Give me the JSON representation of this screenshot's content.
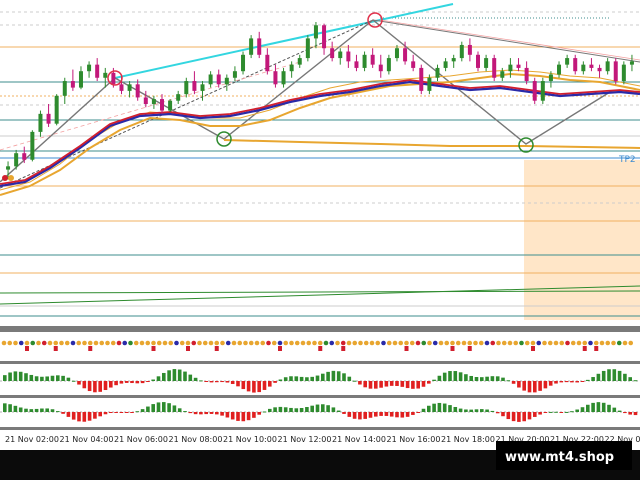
{
  "watermark": "www.mt4.shop",
  "chart_data": {
    "type": "candlestick",
    "symbol": "",
    "x_ticks": [
      "21 Nov 02:00",
      "21 Nov 04:00",
      "21 Nov 06:00",
      "21 Nov 08:00",
      "21 Nov 10:00",
      "21 Nov 12:00",
      "21 Nov 14:00",
      "21 Nov 16:00",
      "21 Nov 18:00",
      "21 Nov 20:00",
      "21 Nov 22:00",
      "22 Nov 0"
    ],
    "price_lines": [
      {
        "label": "",
        "color": "#3e8e8e",
        "style": "dotted"
      },
      {
        "label": "TP2",
        "color": "#3d8bd0",
        "style": "solid"
      }
    ],
    "candles": [
      [
        0.1,
        0.15,
        0.04,
        0.12
      ],
      [
        0.12,
        0.22,
        0.1,
        0.2
      ],
      [
        0.2,
        0.24,
        0.14,
        0.16
      ],
      [
        0.16,
        0.34,
        0.15,
        0.33
      ],
      [
        0.33,
        0.46,
        0.3,
        0.44
      ],
      [
        0.44,
        0.5,
        0.36,
        0.38
      ],
      [
        0.38,
        0.56,
        0.37,
        0.55
      ],
      [
        0.55,
        0.66,
        0.5,
        0.64
      ],
      [
        0.64,
        0.71,
        0.58,
        0.6
      ],
      [
        0.6,
        0.73,
        0.59,
        0.7
      ],
      [
        0.7,
        0.76,
        0.66,
        0.74
      ],
      [
        0.74,
        0.78,
        0.64,
        0.66
      ],
      [
        0.66,
        0.72,
        0.6,
        0.69
      ],
      [
        0.69,
        0.72,
        0.6,
        0.62
      ],
      [
        0.62,
        0.67,
        0.56,
        0.58
      ],
      [
        0.58,
        0.64,
        0.54,
        0.62
      ],
      [
        0.62,
        0.65,
        0.52,
        0.54
      ],
      [
        0.54,
        0.58,
        0.48,
        0.5
      ],
      [
        0.5,
        0.55,
        0.47,
        0.53
      ],
      [
        0.53,
        0.56,
        0.44,
        0.46
      ],
      [
        0.46,
        0.53,
        0.45,
        0.52
      ],
      [
        0.52,
        0.58,
        0.5,
        0.56
      ],
      [
        0.56,
        0.66,
        0.54,
        0.64
      ],
      [
        0.64,
        0.7,
        0.56,
        0.58
      ],
      [
        0.58,
        0.64,
        0.52,
        0.62
      ],
      [
        0.62,
        0.7,
        0.6,
        0.68
      ],
      [
        0.68,
        0.71,
        0.6,
        0.62
      ],
      [
        0.62,
        0.68,
        0.58,
        0.66
      ],
      [
        0.66,
        0.73,
        0.64,
        0.7
      ],
      [
        0.7,
        0.82,
        0.68,
        0.8
      ],
      [
        0.8,
        0.92,
        0.78,
        0.9
      ],
      [
        0.9,
        0.94,
        0.78,
        0.8
      ],
      [
        0.8,
        0.84,
        0.68,
        0.7
      ],
      [
        0.7,
        0.74,
        0.6,
        0.62
      ],
      [
        0.62,
        0.72,
        0.6,
        0.7
      ],
      [
        0.7,
        0.76,
        0.66,
        0.74
      ],
      [
        0.74,
        0.8,
        0.72,
        0.78
      ],
      [
        0.78,
        0.92,
        0.76,
        0.9
      ],
      [
        0.9,
        1.0,
        0.84,
        0.98
      ],
      [
        0.98,
        0.99,
        0.8,
        0.84
      ],
      [
        0.84,
        0.88,
        0.76,
        0.78
      ],
      [
        0.78,
        0.84,
        0.74,
        0.82
      ],
      [
        0.82,
        0.86,
        0.72,
        0.76
      ],
      [
        0.76,
        0.8,
        0.7,
        0.72
      ],
      [
        0.72,
        0.82,
        0.7,
        0.8
      ],
      [
        0.8,
        0.84,
        0.72,
        0.74
      ],
      [
        0.74,
        0.8,
        0.66,
        0.7
      ],
      [
        0.7,
        0.8,
        0.68,
        0.78
      ],
      [
        0.78,
        0.86,
        0.76,
        0.84
      ],
      [
        0.84,
        0.88,
        0.74,
        0.76
      ],
      [
        0.76,
        0.8,
        0.7,
        0.72
      ],
      [
        0.72,
        0.74,
        0.56,
        0.58
      ],
      [
        0.58,
        0.68,
        0.56,
        0.66
      ],
      [
        0.66,
        0.74,
        0.64,
        0.72
      ],
      [
        0.72,
        0.78,
        0.7,
        0.76
      ],
      [
        0.76,
        0.8,
        0.72,
        0.78
      ],
      [
        0.78,
        0.88,
        0.76,
        0.86
      ],
      [
        0.86,
        0.9,
        0.76,
        0.8
      ],
      [
        0.8,
        0.82,
        0.7,
        0.72
      ],
      [
        0.72,
        0.8,
        0.7,
        0.78
      ],
      [
        0.78,
        0.8,
        0.64,
        0.66
      ],
      [
        0.66,
        0.72,
        0.64,
        0.7
      ],
      [
        0.7,
        0.78,
        0.66,
        0.74
      ],
      [
        0.74,
        0.78,
        0.7,
        0.72
      ],
      [
        0.72,
        0.76,
        0.62,
        0.64
      ],
      [
        0.64,
        0.66,
        0.5,
        0.52
      ],
      [
        0.52,
        0.66,
        0.5,
        0.64
      ],
      [
        0.64,
        0.7,
        0.6,
        0.68
      ],
      [
        0.68,
        0.76,
        0.66,
        0.74
      ],
      [
        0.74,
        0.8,
        0.72,
        0.78
      ],
      [
        0.78,
        0.8,
        0.68,
        0.7
      ],
      [
        0.7,
        0.76,
        0.68,
        0.74
      ],
      [
        0.74,
        0.78,
        0.7,
        0.72
      ],
      [
        0.72,
        0.74,
        0.66,
        0.7
      ],
      [
        0.7,
        0.78,
        0.68,
        0.76
      ],
      [
        0.76,
        0.78,
        0.62,
        0.64
      ],
      [
        0.64,
        0.76,
        0.62,
        0.74
      ],
      [
        0.74,
        0.8,
        0.7,
        0.76
      ]
    ]
  }
}
